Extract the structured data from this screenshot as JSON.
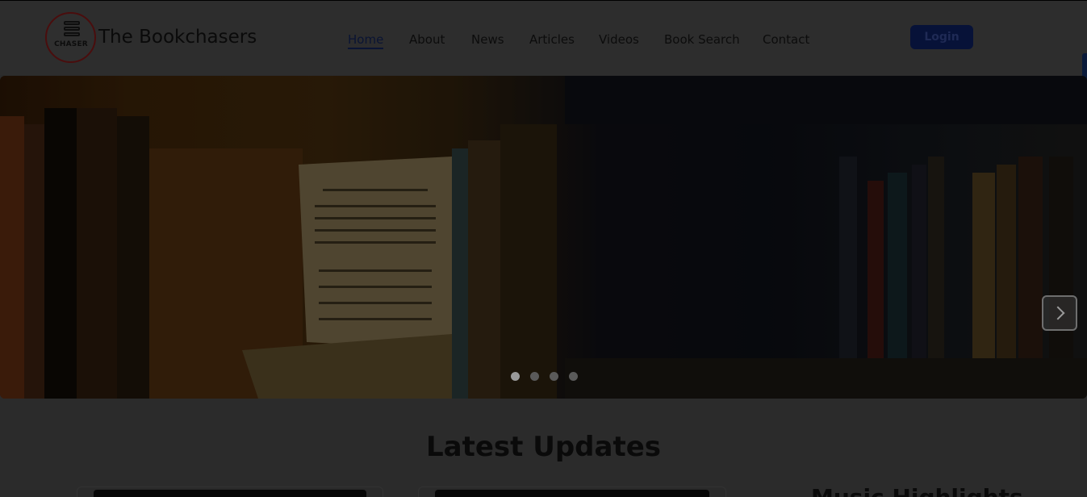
{
  "header": {
    "logo_text": "CHASER",
    "brand": "The Bookchasers",
    "nav": [
      "Home",
      "About",
      "News",
      "Articles",
      "Videos",
      "Book Search",
      "Contact"
    ],
    "active_nav": "Home",
    "login_label": "Login"
  },
  "hero": {
    "slide_count": 4,
    "active_slide": 1
  },
  "latest": {
    "title": "Latest Updates",
    "side_heading": "Music Highlights"
  },
  "colors": {
    "accent": "#071238",
    "overlay": "rgba(0,0,0,0.35)"
  }
}
